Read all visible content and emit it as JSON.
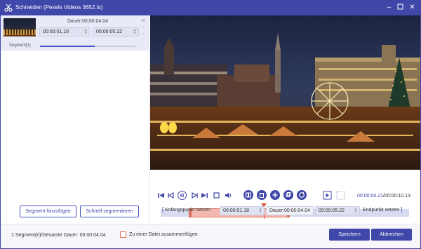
{
  "window": {
    "title": "Schneiden (Pexels Videos 3652.ts)",
    "minimize_icon": "minimize-icon",
    "maximize_icon": "maximize-icon",
    "close_icon": "close-icon"
  },
  "segment_card": {
    "duration_label": "Dauer:00:00:04.04",
    "start_time": "00:00:01.18",
    "end_time": "00:00:05.22",
    "segment_name": "Segment[1]"
  },
  "left_buttons": {
    "add_segment": "Segment hinzufügen",
    "quick_split": "Schnell segmentieren"
  },
  "player": {
    "current_time": "00:00:04.21",
    "total_time": "/00:00:10.13",
    "selection_start_fraction": 0.116,
    "selection_end_fraction": 0.516,
    "playhead_fraction": 0.415
  },
  "trim_bar": {
    "set_start_label": "Anfangspunkt setzen",
    "start_value": "00:00:01.18",
    "duration_label": "Dauer:00:00:04.04",
    "end_value": "00:00:05.22",
    "set_end_label": "Endpunkt setzen"
  },
  "bottom": {
    "status": "1 Segment(e)/Gesamte Dauer: 00:00:04.04",
    "merge_label": "Zu einer Datei zusammenfügen",
    "save_label": "Speichern",
    "cancel_label": "Abbrechen"
  },
  "colors": {
    "accent": "#3f47a8",
    "selection": "#f3b9b0",
    "handle": "#e0705d"
  }
}
